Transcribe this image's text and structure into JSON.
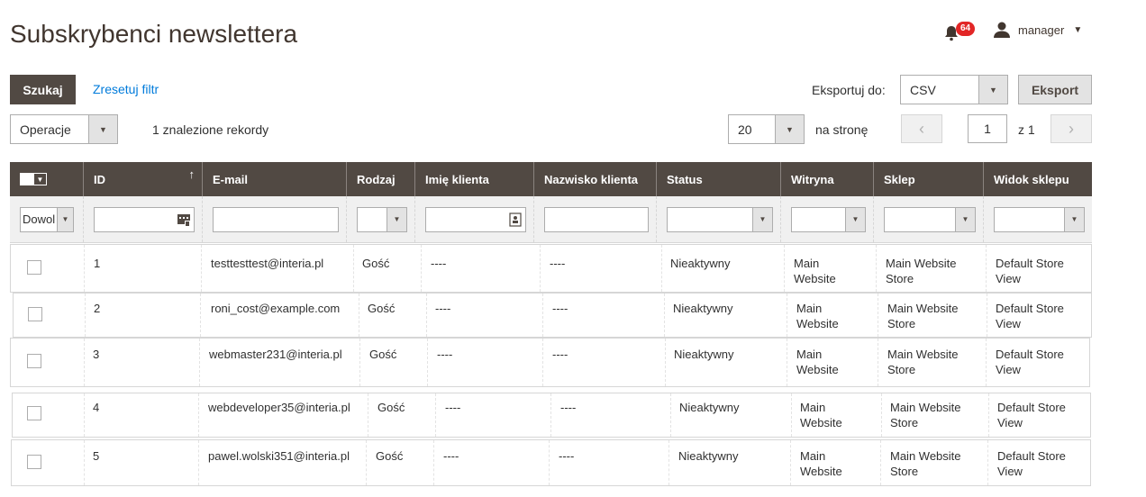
{
  "page": {
    "title": "Subskrybenci newslettera"
  },
  "header": {
    "notifications_count": "64",
    "user_name": "manager"
  },
  "toolbar": {
    "search_label": "Szukaj",
    "reset_label": "Zresetuj filtr",
    "export_label": "Eksportuj do:",
    "export_format": "CSV",
    "export_button": "Eksport",
    "actions_label": "Operacje",
    "records_found": "1 znalezione rekordy",
    "per_page": "20",
    "per_page_label": "na stronę",
    "current_page": "1",
    "page_of": "z 1"
  },
  "columns": [
    {
      "label": ""
    },
    {
      "label": "ID"
    },
    {
      "label": "E-mail"
    },
    {
      "label": "Rodzaj"
    },
    {
      "label": "Imię klienta"
    },
    {
      "label": "Nazwisko klienta"
    },
    {
      "label": "Status"
    },
    {
      "label": "Witryna"
    },
    {
      "label": "Sklep"
    },
    {
      "label": "Widok sklepu"
    }
  ],
  "filters": {
    "mass_select": "Dowol"
  },
  "rows": [
    {
      "id": "1",
      "email": "testtesttest@interia.pl",
      "type": "Gość",
      "first": "----",
      "last": "----",
      "status": "Nieaktywny",
      "website_1": "Main",
      "website_2": "Website",
      "store_1": "Main Website",
      "store_2": "Store",
      "view_1": "Default Store",
      "view_2": "View"
    },
    {
      "id": "2",
      "email": "roni_cost@example.com",
      "type": "Gość",
      "first": "----",
      "last": "----",
      "status": "Nieaktywny",
      "website_1": "Main",
      "website_2": "Website",
      "store_1": "Main Website",
      "store_2": "Store",
      "view_1": "Default Store",
      "view_2": "View"
    },
    {
      "id": "3",
      "email": "webmaster231@interia.pl",
      "type": "Gość",
      "first": "----",
      "last": "----",
      "status": "Nieaktywny",
      "website_1": "Main",
      "website_2": "Website",
      "store_1": "Main Website",
      "store_2": "Store",
      "view_1": "Default Store",
      "view_2": "View"
    },
    {
      "id": "4",
      "email": "webdeveloper35@interia.pl",
      "type": "Gość",
      "first": "----",
      "last": "----",
      "status": "Nieaktywny",
      "website_1": "Main",
      "website_2": "Website",
      "store_1": "Main Website",
      "store_2": "Store",
      "view_1": "Default Store",
      "view_2": "View"
    },
    {
      "id": "5",
      "email": "pawel.wolski351@interia.pl",
      "type": "Gość",
      "first": "----",
      "last": "----",
      "status": "Nieaktywny",
      "website_1": "Main",
      "website_2": "Website",
      "store_1": "Main Website",
      "store_2": "Store",
      "view_1": "Default Store",
      "view_2": "View"
    }
  ]
}
